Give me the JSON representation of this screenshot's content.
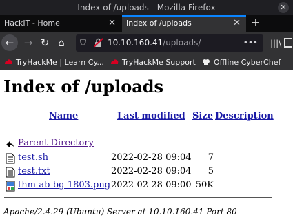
{
  "window": {
    "title": "Index of /uploads - Mozilla Firefox"
  },
  "tabs": [
    {
      "label": "HackIT - Home",
      "active": false
    },
    {
      "label": "Index of /uploads",
      "active": true
    }
  ],
  "toolbar": {
    "url_host": "10.10.160.41",
    "url_path": "/uploads/",
    "more_label": "•••"
  },
  "bookmarks": [
    {
      "label": "TryHackMe | Learn Cy..."
    },
    {
      "label": "TryHackMe Support"
    },
    {
      "label": "Offline CyberChef"
    }
  ],
  "listing": {
    "heading": "Index of /uploads",
    "columns": {
      "name": "Name",
      "modified": "Last modified",
      "size": "Size",
      "description": "Description"
    },
    "parent": {
      "label": "Parent Directory",
      "size": "-"
    },
    "files": [
      {
        "name": "test.sh",
        "modified": "2022-02-28 09:04",
        "size": "7",
        "icon": "text-file-icon"
      },
      {
        "name": "test.txt",
        "modified": "2022-02-28 09:04",
        "size": "5",
        "icon": "text-file-icon"
      },
      {
        "name": "thm-ab-bg-1803.png",
        "modified": "2022-02-28 09:00",
        "size": "50K",
        "icon": "image-file-icon"
      }
    ],
    "address": "Apache/2.4.29 (Ubuntu) Server at 10.10.160.41 Port 80"
  },
  "colors": {
    "accent": "#0a84ff",
    "link": "#1a1aa6",
    "visited": "#551a8b",
    "warning": "#d70022"
  }
}
